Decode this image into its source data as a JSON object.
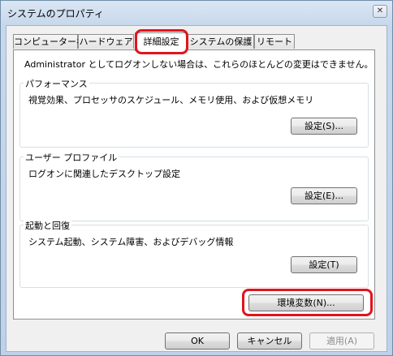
{
  "window": {
    "title": "システムのプロパティ",
    "close_glyph": "✕"
  },
  "tabs": [
    {
      "label": "コンピューター名"
    },
    {
      "label": "ハードウェア"
    },
    {
      "label": "詳細設定"
    },
    {
      "label": "システムの保護"
    },
    {
      "label": "リモート"
    }
  ],
  "active_tab": "詳細設定",
  "highlight_color": "#e0141e",
  "admin_note": "Administrator としてログオンしない場合は、これらのほとんどの変更はできません。",
  "performance": {
    "title": "パフォーマンス",
    "description": "視覚効果、プロセッサのスケジュール、メモリ使用、および仮想メモリ",
    "button": "設定(S)..."
  },
  "user_profile": {
    "title": "ユーザー プロファイル",
    "description": "ログオンに関連したデスクトップ設定",
    "button": "設定(E)..."
  },
  "startup_recovery": {
    "title": "起動と回復",
    "description": "システム起動、システム障害、およびデバッグ情報",
    "button": "設定(T)"
  },
  "env_button": "環境変数(N)...",
  "footer": {
    "ok": "OK",
    "cancel": "キャンセル",
    "apply": "適用(A)"
  }
}
